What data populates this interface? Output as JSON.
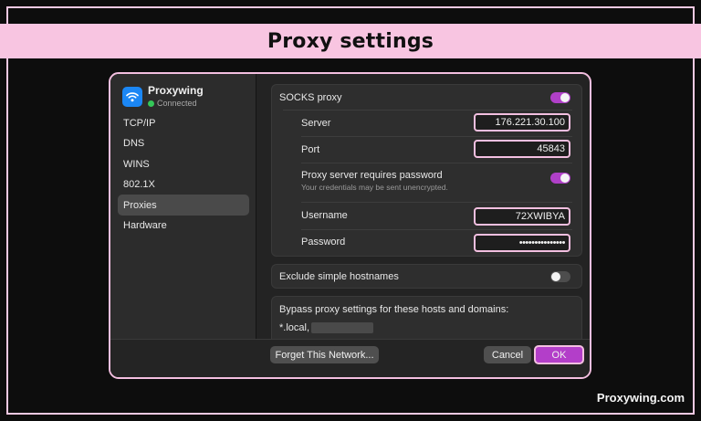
{
  "banner": {
    "title": "Proxy settings"
  },
  "network": {
    "name": "Proxywing",
    "status": "Connected",
    "icon": "wifi-icon"
  },
  "sidebar": {
    "items": [
      {
        "label": "TCP/IP",
        "active": false
      },
      {
        "label": "DNS",
        "active": false
      },
      {
        "label": "WINS",
        "active": false
      },
      {
        "label": "802.1X",
        "active": false
      },
      {
        "label": "Proxies",
        "active": true
      },
      {
        "label": "Hardware",
        "active": false
      }
    ]
  },
  "socks": {
    "label": "SOCKS proxy",
    "enabled": true,
    "server_label": "Server",
    "server_value": "176.221.30.100",
    "port_label": "Port",
    "port_value": "45843",
    "auth_label": "Proxy server requires password",
    "auth_note": "Your credentials may be sent unencrypted.",
    "auth_enabled": true,
    "username_label": "Username",
    "username_value": "72XWIBYA",
    "password_label": "Password",
    "password_value": "•••••••••••••••"
  },
  "exclude": {
    "label": "Exclude simple hostnames",
    "enabled": false
  },
  "bypass": {
    "label": "Bypass proxy settings for these hosts and domains:",
    "value": "*.local,"
  },
  "footer": {
    "forget_label": "Forget This Network...",
    "cancel_label": "Cancel",
    "ok_label": "OK"
  },
  "brand": {
    "text": "Proxywing.com"
  },
  "colors": {
    "accent": "#b33ec9",
    "highlight": "#f8c5e1",
    "connected": "#35c759",
    "wifi": "#1b87f5"
  }
}
